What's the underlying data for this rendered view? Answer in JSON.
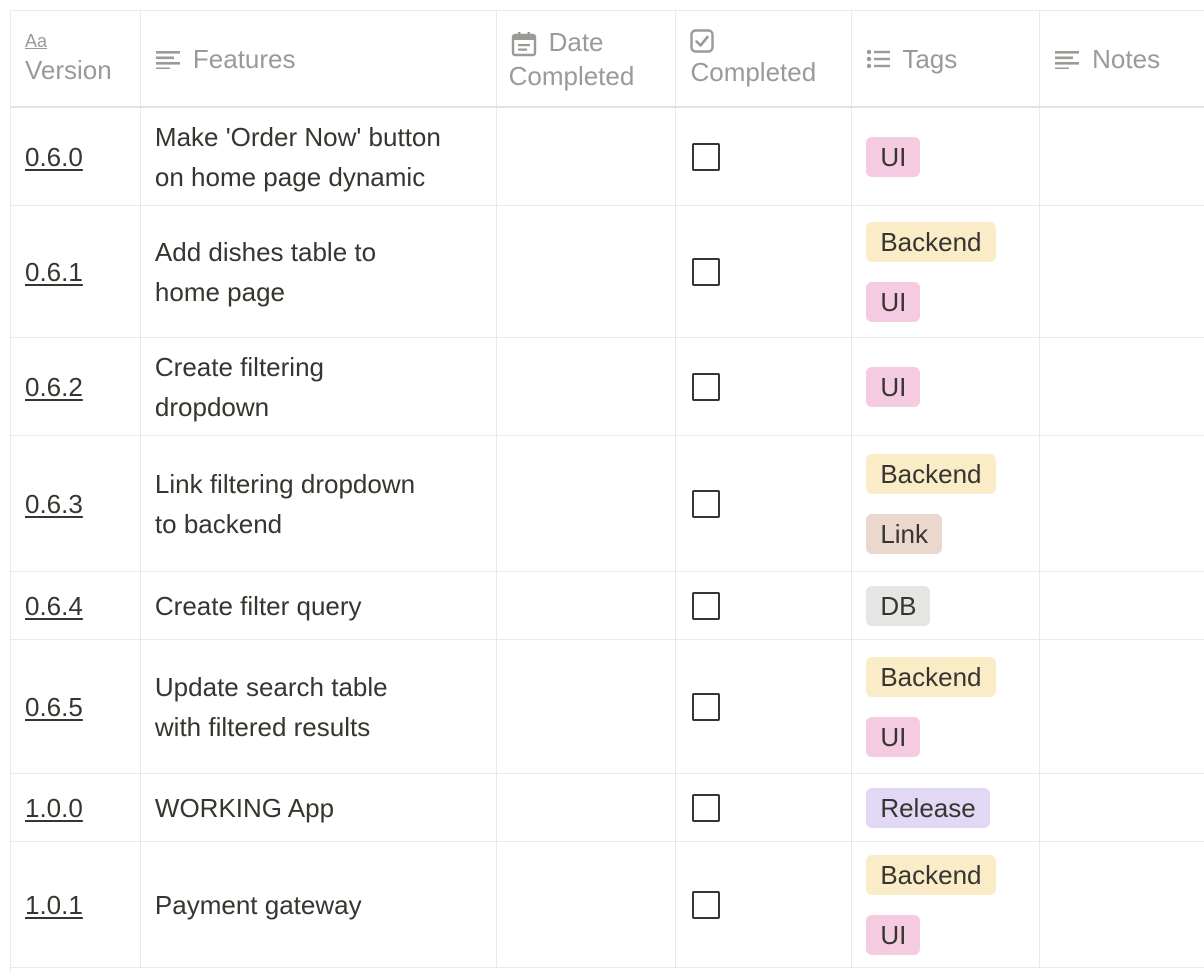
{
  "columns": {
    "version": "Version",
    "features": "Features",
    "date_completed_line1": "Date",
    "date_completed_line2": "Completed",
    "completed": "Completed",
    "tags": "Tags",
    "notes": "Notes",
    "version_icon_text": "Aa"
  },
  "tag_colors": {
    "UI": "#f5cbe1",
    "Backend": "#fbecc8",
    "Link": "#ead7cd",
    "DB": "#e5e5e3",
    "Release": "#e2d7f5"
  },
  "rows": [
    {
      "version": "0.6.0",
      "feature_line1": "Make 'Order Now' button",
      "feature_line2": "on home page dynamic",
      "completed": false,
      "tags": [
        "UI"
      ]
    },
    {
      "version": "0.6.1",
      "feature_line1": "Add dishes table to",
      "feature_line2": "home page",
      "completed": false,
      "tags": [
        "Backend",
        "UI"
      ]
    },
    {
      "version": "0.6.2",
      "feature_line1": "Create filtering",
      "feature_line2": "dropdown",
      "completed": false,
      "tags": [
        "UI"
      ]
    },
    {
      "version": "0.6.3",
      "feature_line1": "Link filtering dropdown",
      "feature_line2": "to backend",
      "completed": false,
      "tags": [
        "Backend",
        "Link"
      ]
    },
    {
      "version": "0.6.4",
      "feature_line1": "Create filter query",
      "feature_line2": "",
      "completed": false,
      "tags": [
        "DB"
      ]
    },
    {
      "version": "0.6.5",
      "feature_line1": "Update search table",
      "feature_line2": "with filtered results",
      "completed": false,
      "tags": [
        "Backend",
        "UI"
      ]
    },
    {
      "version": "1.0.0",
      "feature_line1": "WORKING App",
      "feature_line2": "",
      "completed": false,
      "tags": [
        "Release"
      ]
    },
    {
      "version": "1.0.1",
      "feature_line1": "Payment gateway",
      "feature_line2": "",
      "completed": false,
      "tags": [
        "Backend",
        "UI"
      ]
    }
  ]
}
